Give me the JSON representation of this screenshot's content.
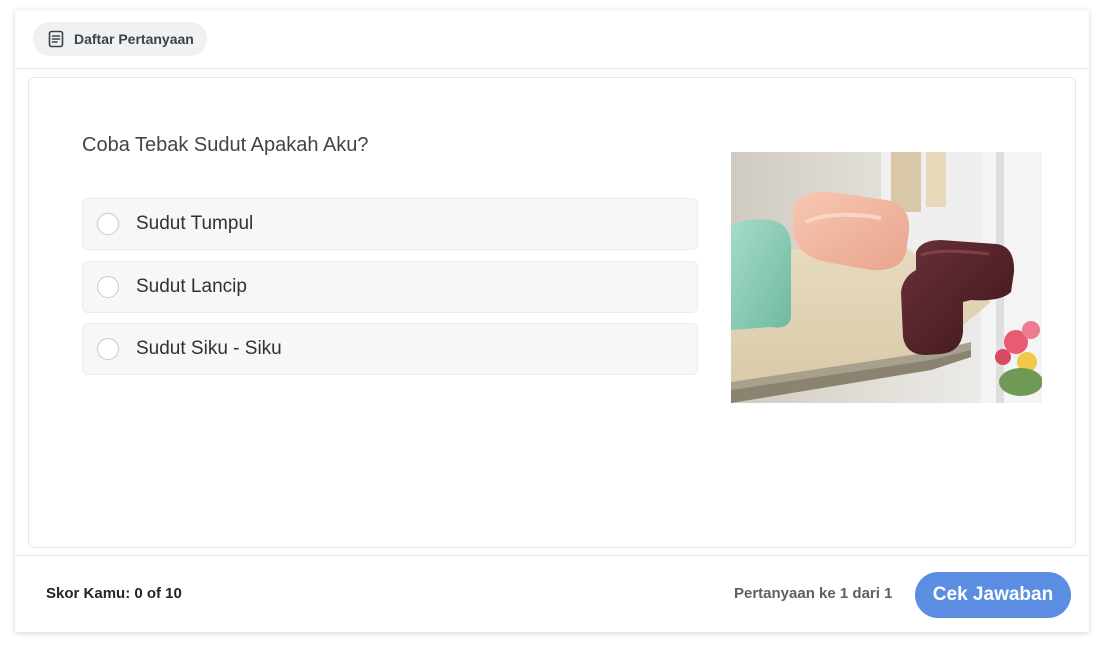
{
  "header": {
    "question_list_label": "Daftar Pertanyaan",
    "question_list_icon": "list-document-icon"
  },
  "question": {
    "text": "Coba Tebak Sudut Apakah Aku?",
    "options": [
      {
        "label": "Sudut Tumpul",
        "selected": false
      },
      {
        "label": "Sudut Lancip",
        "selected": false
      },
      {
        "label": "Sudut Siku - Siku",
        "selected": false
      }
    ],
    "image_alt": "corner protectors on table edge"
  },
  "footer": {
    "score_label": "Skor Kamu: 0 of 10",
    "progress_label": "Pertanyaan ke 1 dari 1",
    "check_button_label": "Cek Jawaban"
  },
  "colors": {
    "accent": "#5b8ee2",
    "pill_bg": "#f0f1f2",
    "option_bg": "#f7f7f7"
  }
}
